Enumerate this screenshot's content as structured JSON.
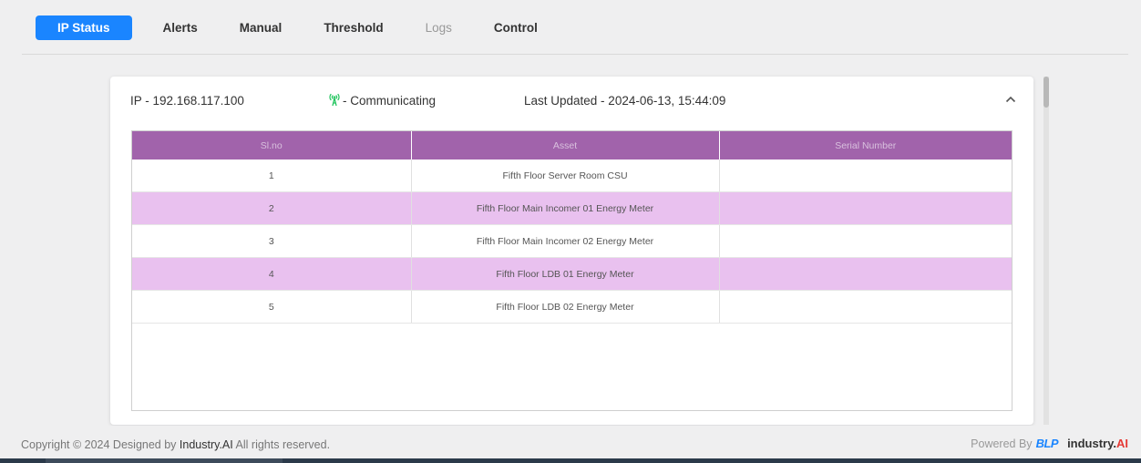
{
  "tabs": [
    {
      "label": "IP Status"
    },
    {
      "label": "Alerts"
    },
    {
      "label": "Manual"
    },
    {
      "label": "Threshold"
    },
    {
      "label": "Logs"
    },
    {
      "label": "Control"
    }
  ],
  "card": {
    "ip": "IP - 192.168.117.100",
    "status": "- Communicating",
    "status_color": "#22c55e",
    "last_updated": "Last Updated - 2024-06-13, 15:44:09",
    "collapse_icon": "chevron-up-icon"
  },
  "table": {
    "headers": [
      "Sl.no",
      "Asset",
      "Serial Number"
    ],
    "rows": [
      {
        "slno": "1",
        "asset": "Fifth Floor Server Room CSU",
        "serial": ""
      },
      {
        "slno": "2",
        "asset": "Fifth Floor Main Incomer 01 Energy Meter",
        "serial": ""
      },
      {
        "slno": "3",
        "asset": "Fifth Floor Main Incomer 02 Energy Meter",
        "serial": ""
      },
      {
        "slno": "4",
        "asset": "Fifth Floor LDB 01 Energy Meter",
        "serial": ""
      },
      {
        "slno": "5",
        "asset": "Fifth Floor LDB 02 Energy Meter",
        "serial": ""
      }
    ]
  },
  "footer": {
    "copyright_prefix": "Copyright © 2024 Designed by",
    "brand": "Industry.AI",
    "copyright_suffix": "All rights reserved.",
    "powered_by": "Powered By",
    "logo_blp": "BLP",
    "logo_industry": "industry.",
    "logo_ai": "AI"
  },
  "colors": {
    "accent": "#1a85ff",
    "table_header": "#a163ab",
    "row_alt": "#e9c1ef"
  }
}
